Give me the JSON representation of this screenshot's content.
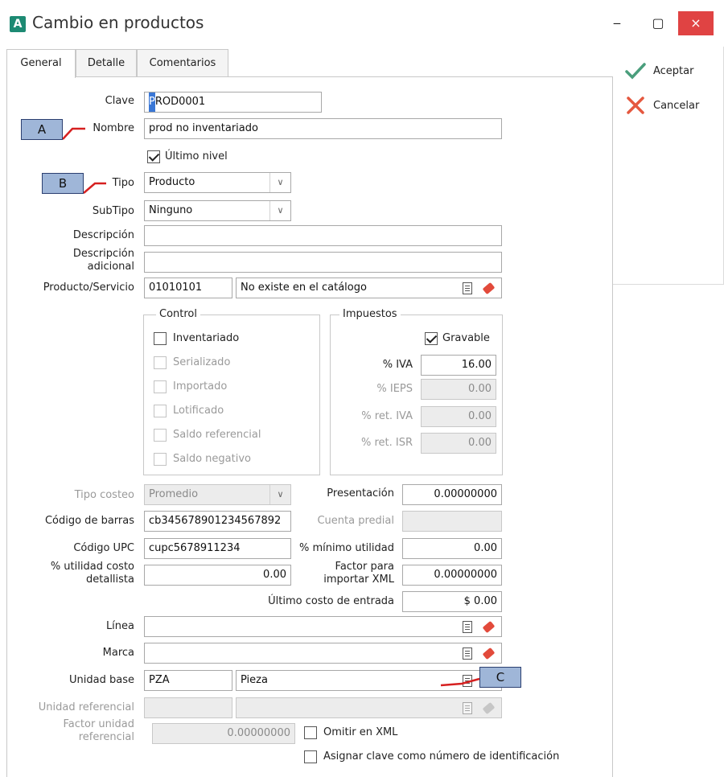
{
  "window": {
    "title": "Cambio en productos",
    "logo_letter": "A",
    "minimize_glyph": "‒",
    "maximize_glyph": "▢",
    "close_glyph": "×"
  },
  "tabs": [
    {
      "label": "General",
      "active": true
    },
    {
      "label": "Detalle",
      "active": false
    },
    {
      "label": "Comentarios",
      "active": false
    }
  ],
  "sidebar": {
    "accept_label": "Aceptar",
    "cancel_label": "Cancelar",
    "accept_icon": "check-icon",
    "cancel_icon": "cross-icon"
  },
  "form": {
    "clave": {
      "label": "Clave",
      "value_first": "P",
      "value_rest": "ROD0001"
    },
    "nombre": {
      "label": "Nombre",
      "value": "prod no inventariado"
    },
    "ultimo_nivel": {
      "label": "Último nivel",
      "checked": true
    },
    "tipo": {
      "label": "Tipo",
      "value": "Producto"
    },
    "subtipo": {
      "label": "SubTipo",
      "value": "Ninguno"
    },
    "descripcion": {
      "label": "Descripción",
      "value": ""
    },
    "descripcion_adicional": {
      "label_line1": "Descripción",
      "label_line2": "adicional",
      "value": ""
    },
    "producto_servicio": {
      "label": "Producto/Servicio",
      "code": "01010101",
      "description": "No existe en el catálogo"
    },
    "control": {
      "title": "Control",
      "items": [
        {
          "label": "Inventariado",
          "enabled": true,
          "checked": false
        },
        {
          "label": "Serializado",
          "enabled": false,
          "checked": false
        },
        {
          "label": "Importado",
          "enabled": false,
          "checked": false
        },
        {
          "label": "Lotificado",
          "enabled": false,
          "checked": false
        },
        {
          "label": "Saldo referencial",
          "enabled": false,
          "checked": false
        },
        {
          "label": "Saldo negativo",
          "enabled": false,
          "checked": false
        }
      ]
    },
    "impuestos": {
      "title": "Impuestos",
      "gravable": {
        "label": "Gravable",
        "checked": true
      },
      "iva": {
        "label": "% IVA",
        "value": "16.00"
      },
      "ieps": {
        "label": "% IEPS",
        "value": "0.00"
      },
      "ret_iva": {
        "label": "% ret. IVA",
        "value": "0.00"
      },
      "ret_isr": {
        "label": "% ret. ISR",
        "value": "0.00"
      }
    },
    "tipo_costeo": {
      "label": "Tipo costeo",
      "value": "Promedio"
    },
    "presentacion": {
      "label": "Presentación",
      "value": "0.00000000"
    },
    "codigo_barras": {
      "label": "Código de barras",
      "value": "cb345678901234567892"
    },
    "cuenta_predial": {
      "label": "Cuenta predial",
      "value": ""
    },
    "codigo_upc": {
      "label": "Código UPC",
      "value": "cupc5678911234"
    },
    "minimo_utilidad": {
      "label": "% mínimo utilidad",
      "value": "0.00"
    },
    "utilidad_detallista": {
      "label_line1": "% utilidad costo",
      "label_line2": "detallista",
      "value": "0.00"
    },
    "factor_xml": {
      "label_line1": "Factor para",
      "label_line2": "importar XML",
      "value": "0.00000000"
    },
    "ultimo_costo": {
      "label": "Último costo de entrada",
      "value": "$ 0.00"
    },
    "linea": {
      "label": "Línea",
      "value": ""
    },
    "marca": {
      "label": "Marca",
      "value": ""
    },
    "unidad_base": {
      "label": "Unidad base",
      "code": "PZA",
      "description": "Pieza"
    },
    "unidad_referencial": {
      "label": "Unidad referencial",
      "code": "",
      "description": ""
    },
    "factor_unidad": {
      "label_line1": "Factor unidad",
      "label_line2": "referencial",
      "value": "0.00000000"
    },
    "omitir_xml": {
      "label": "Omitir en XML",
      "checked": false
    },
    "asignar_clave": {
      "label": "Asignar clave como número de identificación",
      "checked": false
    }
  },
  "callouts": {
    "a": "A",
    "b": "B",
    "c": "C"
  },
  "colors": {
    "close": "#e04343",
    "accept": "#4a9e7c",
    "cancel": "#e5583f",
    "callout": "#9fb6d8",
    "callout_line": "#d62020"
  }
}
